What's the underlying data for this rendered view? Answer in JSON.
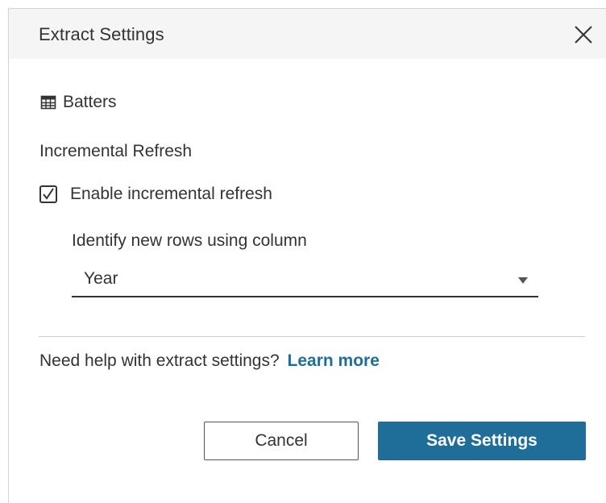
{
  "dialog": {
    "title": "Extract Settings",
    "close_icon": "close-icon"
  },
  "source": {
    "icon": "table-icon",
    "name": "Batters"
  },
  "incremental": {
    "section_label": "Incremental Refresh",
    "checkbox_label": "Enable incremental refresh",
    "checkbox_checked": true,
    "column_label": "Identify new rows using column",
    "column_value": "Year"
  },
  "help": {
    "text": "Need help with extract settings?",
    "link": "Learn more"
  },
  "buttons": {
    "cancel": "Cancel",
    "save": "Save Settings"
  },
  "colors": {
    "accent": "#1f6e99",
    "header_bg": "#f5f5f5",
    "text": "#333333"
  }
}
